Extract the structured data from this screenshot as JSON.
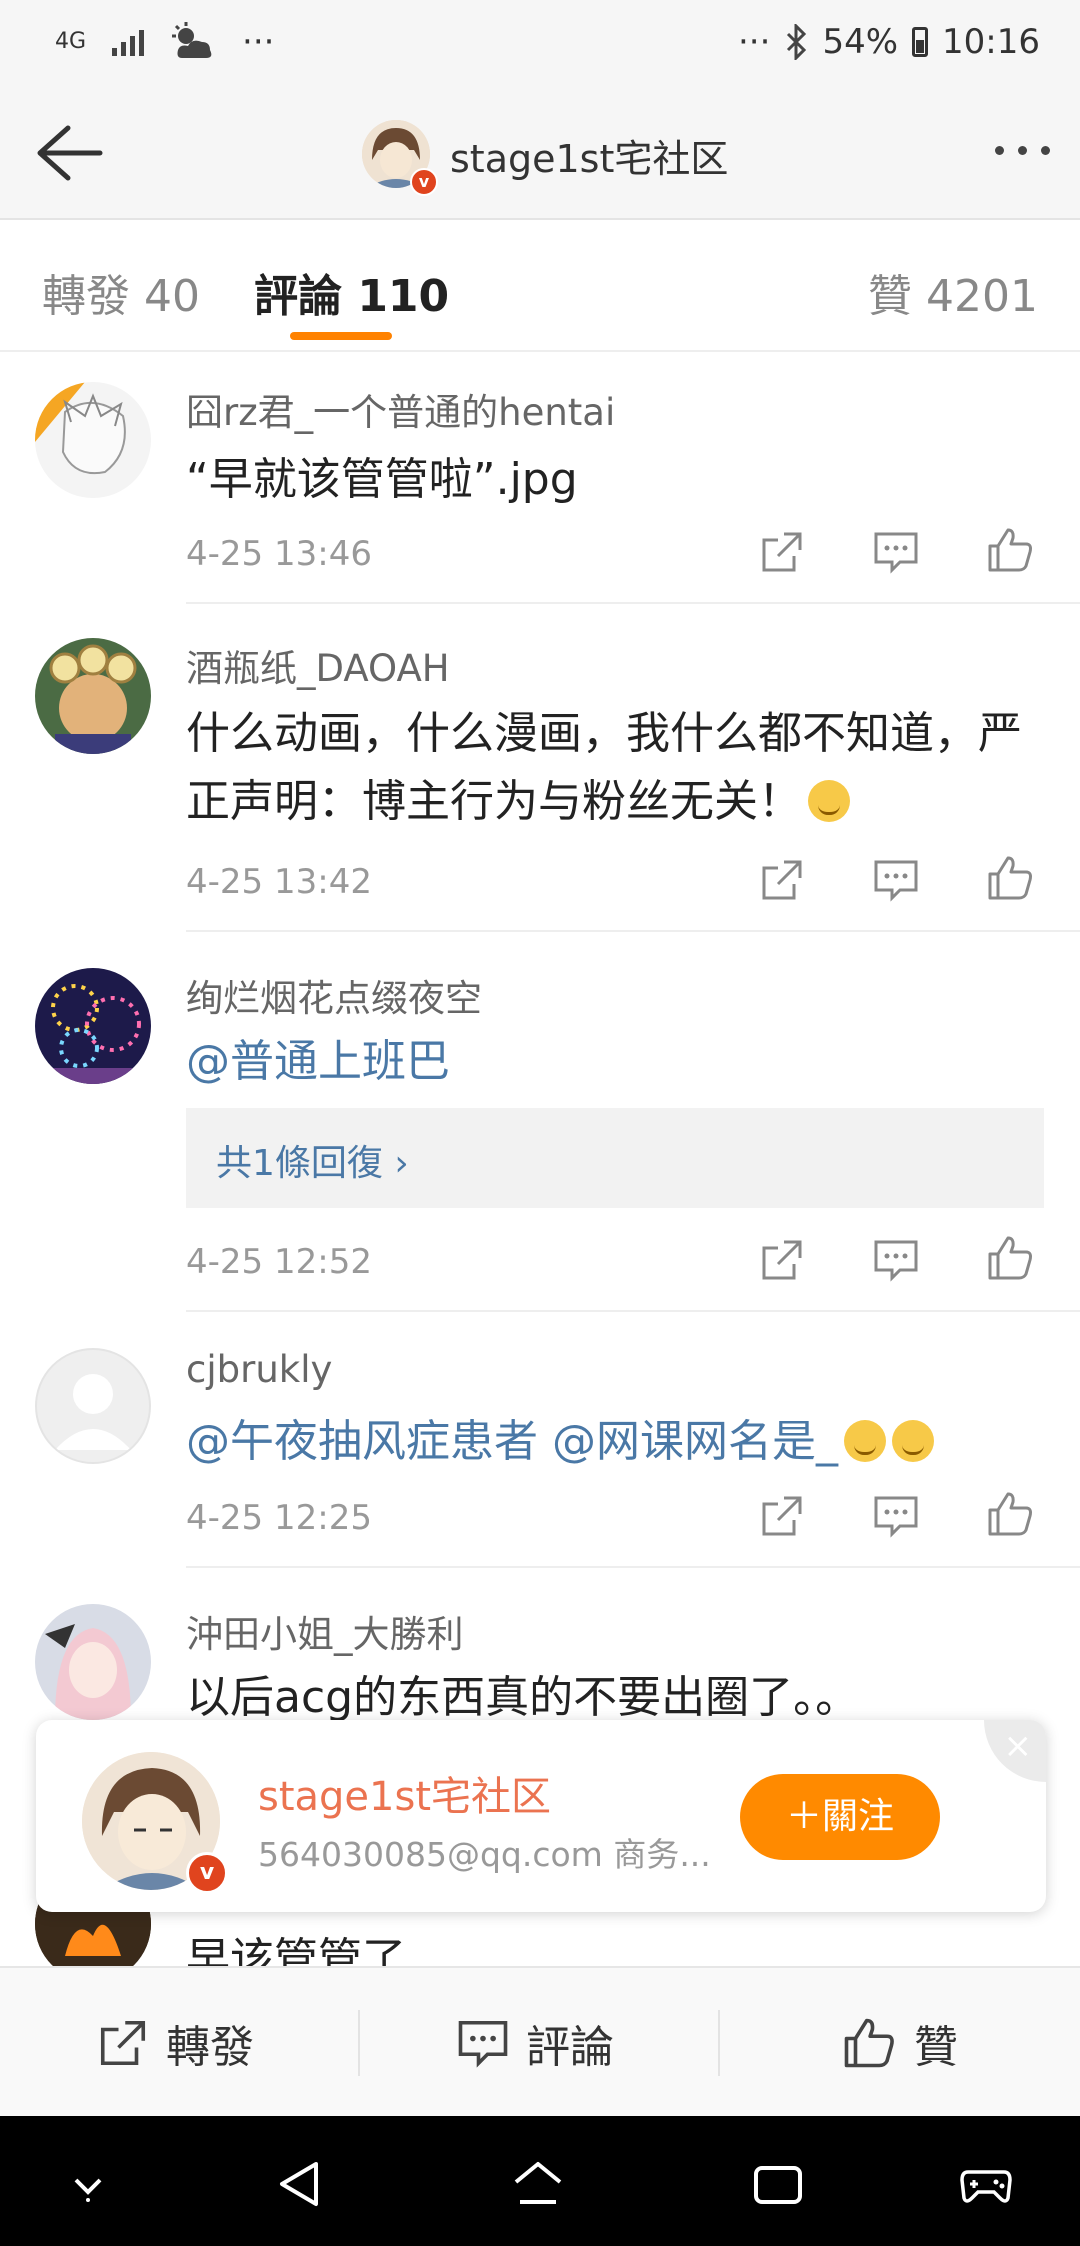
{
  "status_bar": {
    "network": "4G",
    "more_dots": "···",
    "battery": "54%",
    "time": "10:16"
  },
  "header": {
    "title": "stage1st宅社区",
    "verified_badge": "v"
  },
  "tabs": {
    "repost": "轉發 40",
    "comments": "評論 110",
    "likes": "贊 4201"
  },
  "comments": [
    {
      "user": "囧rz君_一个普通的hentai",
      "text": "“早就该管管啦”.jpg",
      "time": "4-25 13:46"
    },
    {
      "user": "酒瓶纸_DAOAH",
      "text": "什么动画，什么漫画，我什么都不知道，严正声明：博主行为与粉丝无关！",
      "time": "4-25 13:42"
    },
    {
      "user": "绚烂烟花点缀夜空",
      "mention": "@普通上班巴",
      "reply_link": "共1條回復 ›",
      "time": "4-25 12:52"
    },
    {
      "user": "cjbrukly",
      "mention1": "@午夜抽风症患者",
      "mention2": "@网课网名是_",
      "time": "4-25 12:25"
    },
    {
      "user": "沖田小姐_大勝利",
      "text": "以后acg的东西真的不要出圈了。。"
    },
    {
      "text": "早该管管了"
    }
  ],
  "follow_card": {
    "name": "stage1st宅社区",
    "desc": "564030085@qq.com 商务...",
    "follow_label": "＋關注",
    "close": "×"
  },
  "action_bar": {
    "repost": "轉發",
    "comment": "評論",
    "like": "贊"
  },
  "colors": {
    "accent": "#ff8200",
    "link": "#4a78a6",
    "follow_button": "#ff8a00",
    "card_name": "#eb7350"
  }
}
